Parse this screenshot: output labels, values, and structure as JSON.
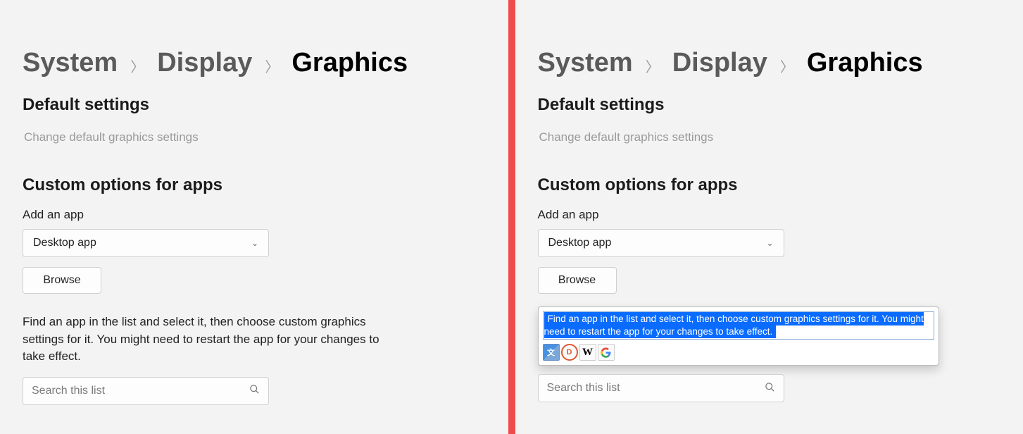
{
  "breadcrumb": {
    "system": "System",
    "display": "Display",
    "graphics": "Graphics"
  },
  "sections": {
    "default_settings_title": "Default settings",
    "change_default_link": "Change default graphics settings",
    "custom_title": "Custom options for apps",
    "add_app_label": "Add an app",
    "app_type_selected": "Desktop app",
    "browse_btn": "Browse",
    "help_text": "Find an app in the list and select it, then choose custom graphics settings for it. You might need to restart the app for your changes to take effect.",
    "search_placeholder": "Search this list"
  },
  "popup": {
    "selected_text": "Find an app in the list and select it, then choose custom graphics settings for it. You might need to restart the app for your changes to take effect.",
    "icons": {
      "translate": "translate-icon",
      "ddg": "duckduckgo-icon",
      "wiki": "wikipedia-icon",
      "google": "google-icon"
    }
  }
}
